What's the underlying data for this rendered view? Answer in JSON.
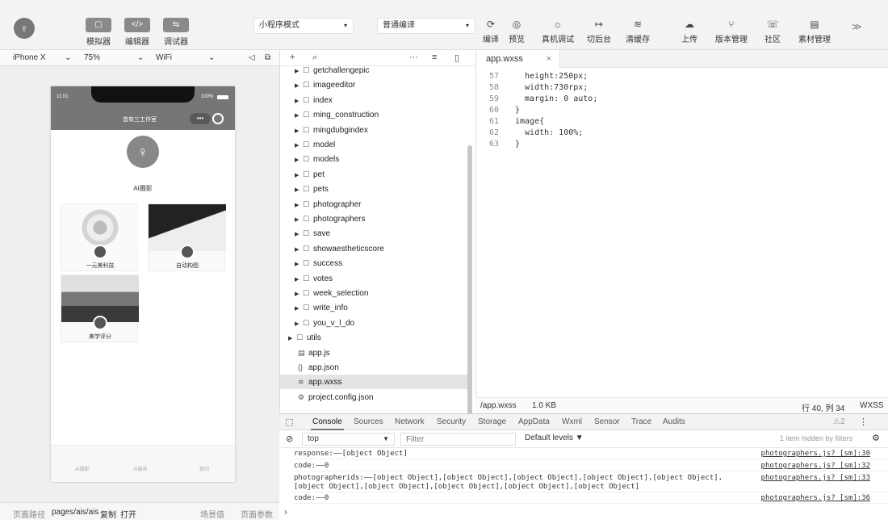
{
  "toolbar": {
    "buttons": [
      {
        "label": "模拟器",
        "glyph": "▢"
      },
      {
        "label": "编辑器",
        "glyph": "</>"
      },
      {
        "label": "调试器",
        "glyph": "⇆"
      }
    ],
    "mode_select": "小程序模式",
    "compile_select": "普通编译",
    "actions": [
      {
        "label": "编译",
        "icon": "refresh-icon",
        "glyph": "⟳"
      },
      {
        "label": "预览",
        "icon": "eye-icon",
        "glyph": "◎"
      },
      {
        "label": "真机调试",
        "icon": "bug-icon",
        "glyph": "☼"
      },
      {
        "label": "切后台",
        "icon": "switch-icon",
        "glyph": "↦"
      },
      {
        "label": "清缓存",
        "icon": "layers-icon",
        "glyph": "≋"
      },
      {
        "label": "上传",
        "icon": "upload-cloud-icon",
        "glyph": "☁"
      },
      {
        "label": "版本管理",
        "icon": "branch-icon",
        "glyph": "⑂"
      },
      {
        "label": "社区",
        "icon": "community-icon",
        "glyph": "☏"
      },
      {
        "label": "素材管理",
        "icon": "material-icon",
        "glyph": "▤"
      }
    ],
    "more": "≫"
  },
  "simulator": {
    "device": "iPhone X",
    "zoom": "75%",
    "network": "WiFi",
    "phone": {
      "time": "11:01",
      "battery": "100%",
      "nav_title": "首有三工作室",
      "menu_dots": "•••",
      "title": "AI摄影",
      "cards": [
        {
          "label": "一元美科技"
        },
        {
          "label": "自动构图"
        },
        {
          "label": "美学评分"
        }
      ],
      "tabs": [
        "AI摄影",
        "AI服务",
        "我的"
      ]
    },
    "path_label": "页面路径",
    "path": "pages/ais/ais",
    "copy": "复制",
    "open": "打开",
    "scene": "场景值",
    "params": "页面参数"
  },
  "explorer": {
    "items": [
      {
        "name": "getchallengepic",
        "type": "folder",
        "level": 1
      },
      {
        "name": "imageeditor",
        "type": "folder",
        "level": 1
      },
      {
        "name": "index",
        "type": "folder",
        "level": 1
      },
      {
        "name": "ming_construction",
        "type": "folder",
        "level": 1
      },
      {
        "name": "mingdubgindex",
        "type": "folder",
        "level": 1
      },
      {
        "name": "model",
        "type": "folder",
        "level": 1
      },
      {
        "name": "models",
        "type": "folder",
        "level": 1
      },
      {
        "name": "pet",
        "type": "folder",
        "level": 1
      },
      {
        "name": "pets",
        "type": "folder",
        "level": 1
      },
      {
        "name": "photographer",
        "type": "folder",
        "level": 1
      },
      {
        "name": "photographers",
        "type": "folder",
        "level": 1
      },
      {
        "name": "save",
        "type": "folder",
        "level": 1
      },
      {
        "name": "showaestheticscore",
        "type": "folder",
        "level": 1
      },
      {
        "name": "success",
        "type": "folder",
        "level": 1
      },
      {
        "name": "votes",
        "type": "folder",
        "level": 1
      },
      {
        "name": "week_selection",
        "type": "folder",
        "level": 1
      },
      {
        "name": "write_info",
        "type": "folder",
        "level": 1
      },
      {
        "name": "you_v_l_do",
        "type": "folder",
        "level": 1
      },
      {
        "name": "utils",
        "type": "folder",
        "level": 0
      },
      {
        "name": "app.js",
        "type": "js",
        "level": 0
      },
      {
        "name": "app.json",
        "type": "json",
        "level": 0
      },
      {
        "name": "app.wxss",
        "type": "wxss",
        "level": 0,
        "selected": true
      },
      {
        "name": "project.config.json",
        "type": "config",
        "level": 0
      }
    ]
  },
  "editor": {
    "tab": "app.wxss",
    "lines": [
      {
        "n": "57",
        "code": "  height:250px;"
      },
      {
        "n": "58",
        "code": "  width:730rpx;"
      },
      {
        "n": "59",
        "code": "  margin: 0 auto;"
      },
      {
        "n": "60",
        "code": "}"
      },
      {
        "n": "61",
        "code": "image{"
      },
      {
        "n": "62",
        "code": "  width: 100%;"
      },
      {
        "n": "63",
        "code": "}"
      }
    ],
    "status_path": "/app.wxss",
    "status_size": "1.0 KB",
    "status_pos": "行 40, 列 34",
    "status_lang": "WXSS"
  },
  "devtools": {
    "tabs": [
      "Console",
      "Sources",
      "Network",
      "Security",
      "Storage",
      "AppData",
      "Wxml",
      "Sensor",
      "Trace",
      "Audits"
    ],
    "active_tab": "Console",
    "warnings": "⚠2",
    "context": "top",
    "filter_placeholder": "Filter",
    "levels": "Default levels ▼",
    "hidden": "1 item hidden by filters",
    "logs": [
      {
        "msg": "response:——[object Object]",
        "src": "photographers.js? [sm]:30"
      },
      {
        "msg": "code:——0",
        "src": "photographers.js? [sm]:32"
      },
      {
        "msg": "photographerids:——[object Object],[object Object],[object Object],[object Object],[object Object],[object Object],[object Object],[object Object],[object Object],[object Object]",
        "src": "photographers.js? [sm]:33"
      },
      {
        "msg": "code:——0",
        "src": "photographers.js? [sm]:36"
      }
    ],
    "prompt": "›"
  }
}
